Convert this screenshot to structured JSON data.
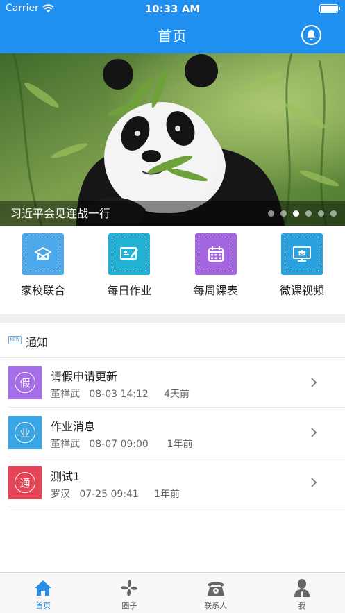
{
  "status_bar": {
    "carrier": "Carrier",
    "time": "10:33 AM"
  },
  "nav": {
    "title": "首页",
    "right_icon": "bell-icon"
  },
  "banner": {
    "caption": "习近平会见连战一行",
    "slide_count": 6,
    "active_index": 2
  },
  "menu": [
    {
      "label": "家校联合",
      "icon": "graduation-cap-icon",
      "color": "#4ea8ec"
    },
    {
      "label": "每日作业",
      "icon": "edit-board-icon",
      "color": "#22b0d4"
    },
    {
      "label": "每周课表",
      "icon": "calendar-icon",
      "color": "#a465e0"
    },
    {
      "label": "微课视频",
      "icon": "monitor-cap-icon",
      "color": "#2aa2e0"
    }
  ],
  "notice": {
    "badge_text": "NEW",
    "title": "通知",
    "items": [
      {
        "avatar_char": "假",
        "avatar_color": "#a66ee8",
        "title": "请假申请更新",
        "author": "董祥武",
        "datetime": "08-03 14:12",
        "ago": "4天前"
      },
      {
        "avatar_char": "业",
        "avatar_color": "#3aa6e6",
        "title": "作业消息",
        "author": "董祥武",
        "datetime": "08-07 09:00",
        "ago": "1年前"
      },
      {
        "avatar_char": "通",
        "avatar_color": "#e44455",
        "title": "测试1",
        "author": "罗汉",
        "datetime": "07-25 09:41",
        "ago": "1年前"
      }
    ]
  },
  "tabbar": [
    {
      "label": "首页",
      "icon": "home-icon",
      "active": true
    },
    {
      "label": "圈子",
      "icon": "pinwheel-icon",
      "active": false
    },
    {
      "label": "联系人",
      "icon": "phone-icon",
      "active": false
    },
    {
      "label": "我",
      "icon": "person-icon",
      "active": false
    }
  ],
  "colors": {
    "primary": "#1f8ff0",
    "tab_active": "#2a8de8"
  }
}
